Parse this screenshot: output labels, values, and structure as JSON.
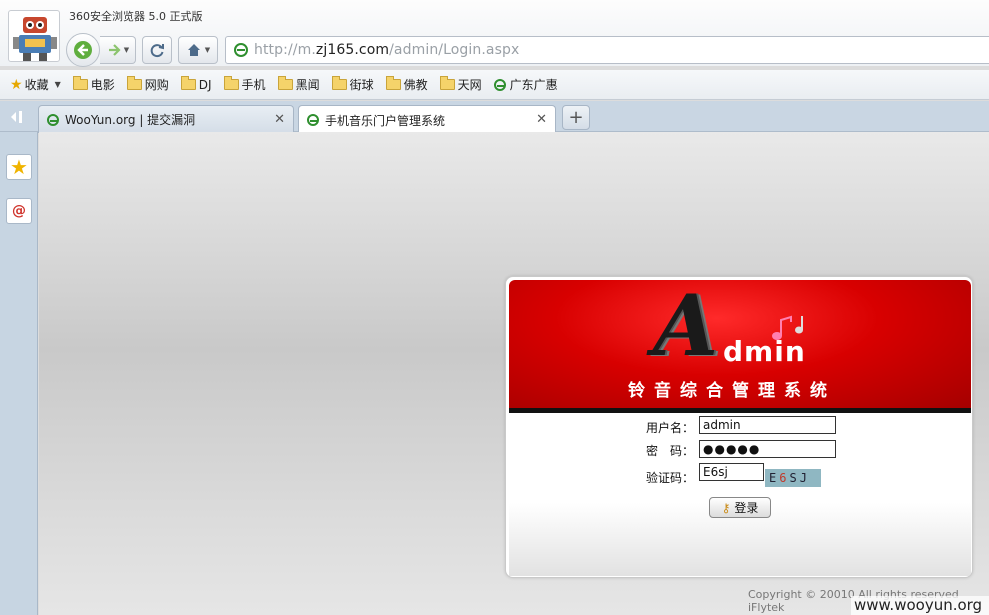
{
  "window": {
    "title": "360安全浏览器 5.0 正式版"
  },
  "address_bar": {
    "prefix": "http://m.",
    "host": "zj165.com",
    "path": "/admin/Login.aspx"
  },
  "favorites": {
    "label": "收藏",
    "items": [
      "电影",
      "网购",
      "DJ",
      "手机",
      "黑闻",
      "街球",
      "佛教",
      "天网",
      "广东广惠"
    ]
  },
  "tabs": [
    {
      "label": "WooYun.org | 提交漏洞",
      "active": false
    },
    {
      "label": "手机音乐门户管理系统",
      "active": true
    }
  ],
  "login": {
    "logo_a": "A",
    "logo_rest": "dmin",
    "system_name": "铃音综合管理系统",
    "username_label": "用户名：",
    "password_label": "密　码：",
    "captcha_label": "验证码：",
    "username_value": "admin",
    "password_value": "●●●●●",
    "captcha_input_value": "E6sj",
    "captcha_text_1": "E",
    "captcha_text_2": "6",
    "captcha_text_3": "SJ",
    "login_button": "登录",
    "brand_red": "#d80000"
  },
  "footer": {
    "copyright": "Copyright © 20010 All rights reserved iFlytek",
    "watermark": "www.wooyun.org"
  }
}
